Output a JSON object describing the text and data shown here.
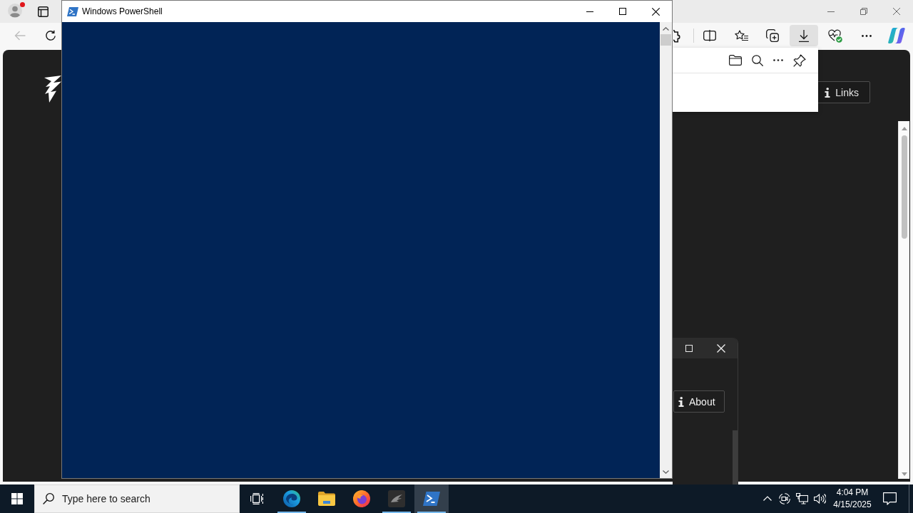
{
  "browser": {
    "profile": {
      "notification": true
    },
    "back_button": {
      "disabled": true
    },
    "toolbar_buttons": [
      {
        "kind": "extensions",
        "selected": false
      },
      {
        "kind": "split-screen",
        "selected": false
      },
      {
        "kind": "favorites",
        "selected": false
      },
      {
        "kind": "collections",
        "selected": false
      },
      {
        "kind": "downloads",
        "selected": true
      },
      {
        "kind": "essentials",
        "selected": false
      },
      {
        "kind": "more",
        "selected": false
      },
      {
        "kind": "copilot",
        "selected": false
      }
    ],
    "page": {
      "links_button": "Links"
    },
    "dialog": {
      "about_button": "About"
    }
  },
  "powershell": {
    "title": "Windows PowerShell"
  },
  "taskbar": {
    "search": {
      "placeholder": "Type here to search"
    },
    "apps": [
      {
        "kind": "edge",
        "running": true,
        "selected": false
      },
      {
        "kind": "explorer",
        "running": false,
        "selected": false
      },
      {
        "kind": "firefox",
        "running": false,
        "selected": false
      },
      {
        "kind": "app",
        "running": true,
        "selected": false
      },
      {
        "kind": "powershell",
        "running": true,
        "selected": true
      }
    ],
    "clock": {
      "time": "4:04 PM",
      "date": "4/15/2025"
    }
  }
}
